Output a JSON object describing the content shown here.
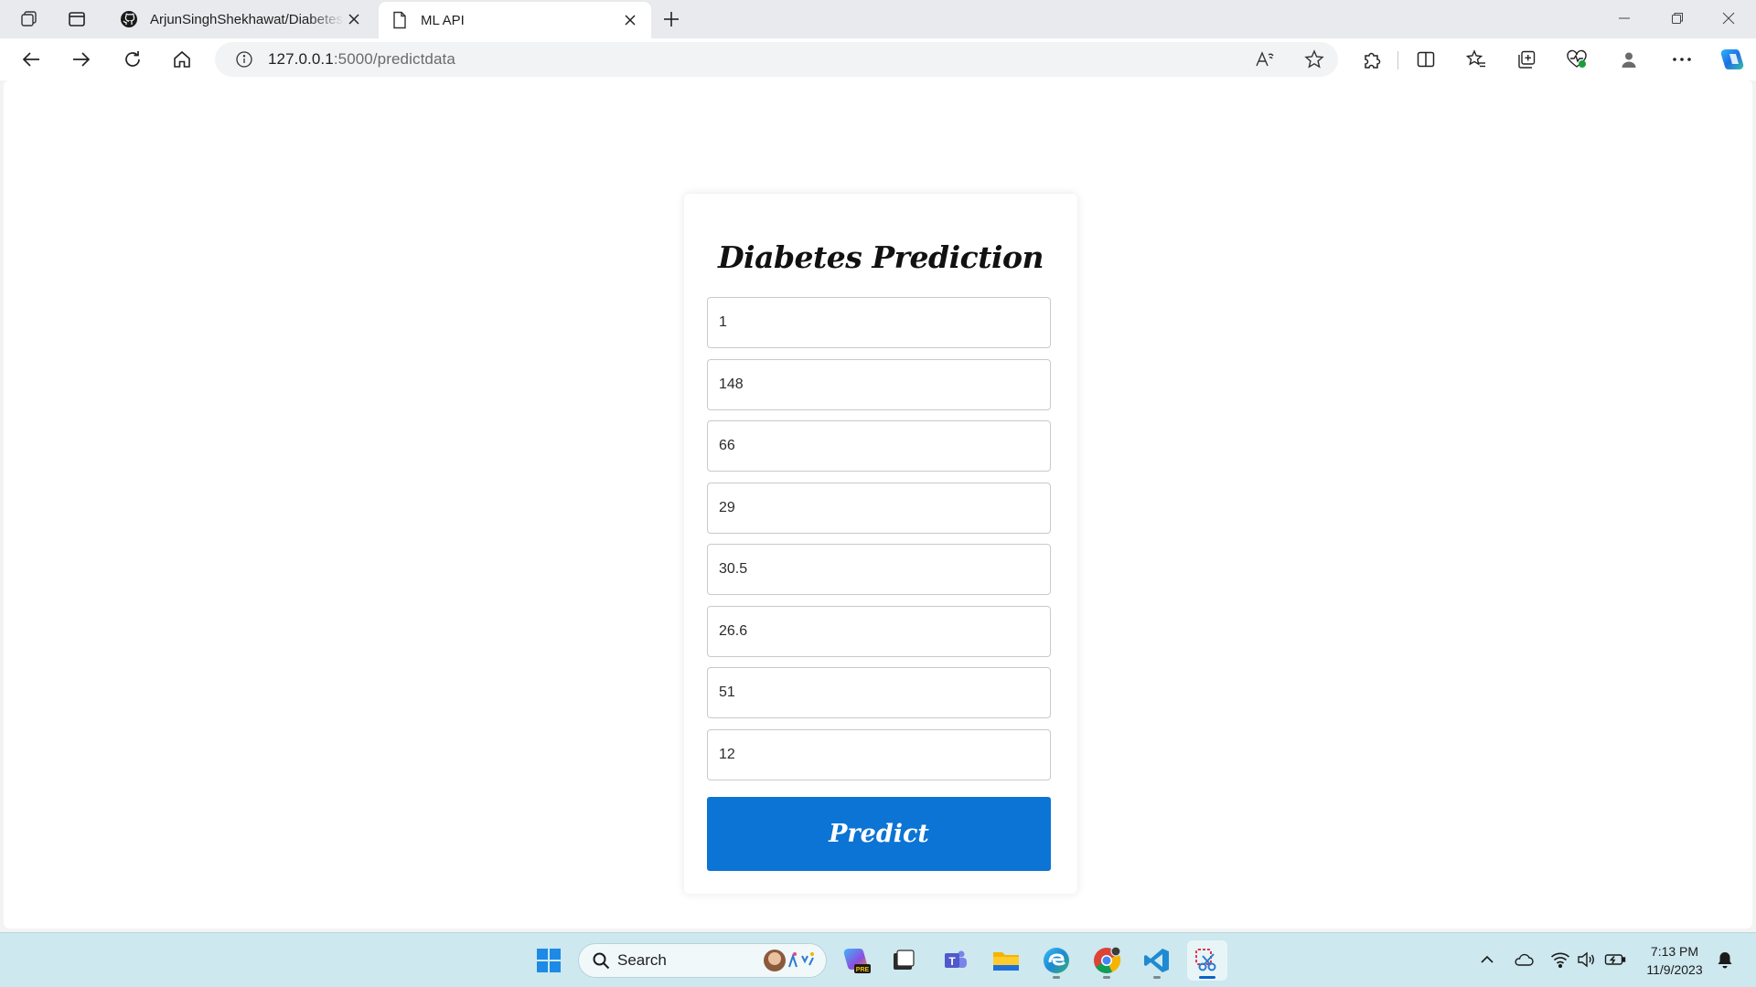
{
  "browser": {
    "tabs": [
      {
        "title": "ArjunSinghShekhawat/Diabetes-",
        "icon": "github-icon"
      },
      {
        "title": "ML API",
        "icon": "page-icon",
        "active": true
      }
    ],
    "address": {
      "host": "127.0.0.1",
      "rest": ":5000/predictdata"
    }
  },
  "page": {
    "title": "Diabetes Prediction",
    "fields": [
      "1",
      "148",
      "66",
      "29",
      "30.5",
      "26.6",
      "51",
      "12"
    ],
    "button_label": "Predict",
    "accent": "#0b74d4"
  },
  "taskbar": {
    "search_label": "Search",
    "time": "7:13 PM",
    "date": "11/9/2023",
    "copilot_badge": "PRE"
  }
}
